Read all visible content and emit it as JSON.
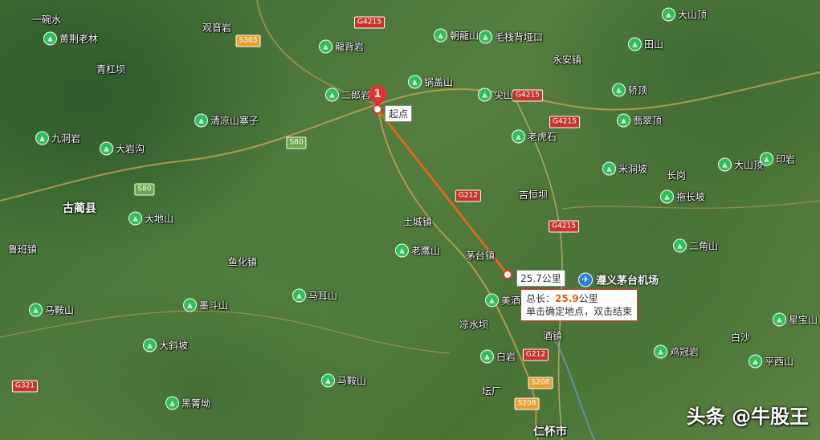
{
  "measure": {
    "start_marker_number": "1",
    "start_label": "起点",
    "segment_label": "25.7公里",
    "popup_total_prefix": "总长：",
    "popup_total_value": "25.9",
    "popup_total_unit": "公里",
    "popup_hint": "单击确定地点，双击结束",
    "line_color": "#e06a1e"
  },
  "airport": {
    "label": "遵义茅台机场",
    "icon": "airplane-icon",
    "color": "#2a7fd6"
  },
  "watermark": "头条 @牛股王",
  "road_shields": [
    {
      "text": "G4215",
      "type": "g"
    },
    {
      "text": "G4215",
      "type": "g"
    },
    {
      "text": "G4215",
      "type": "g"
    },
    {
      "text": "G4215",
      "type": "g"
    },
    {
      "text": "S303",
      "type": "s"
    },
    {
      "text": "S80",
      "type": "e"
    },
    {
      "text": "S80",
      "type": "e"
    },
    {
      "text": "G212",
      "type": "g"
    },
    {
      "text": "G212",
      "type": "g"
    },
    {
      "text": "S208",
      "type": "s"
    },
    {
      "text": "S208",
      "type": "s"
    },
    {
      "text": "G321",
      "type": "g"
    }
  ],
  "peaks": [
    "黄荆老林",
    "龍背岩",
    "二郎岩",
    "锅盖山",
    "尖山",
    "朝龍山",
    "毛栈背垭口",
    "大山顶",
    "田山",
    "轿顶",
    "翡翠顶",
    "清凉山寨子",
    "九洞岩",
    "大岩沟",
    "老虎石",
    "米洞坡",
    "大山顶",
    "印岩",
    "拖长坡",
    "大地山",
    "老鹰山",
    "马耳山",
    "二角山",
    "马鞍山",
    "墨斗山",
    "美酒岩",
    "大斜坡",
    "马鞍山",
    "黑箐坳",
    "白岩",
    "鸡冠岩",
    "星宝山",
    "平西山"
  ],
  "places": [
    {
      "text": "古蔺县",
      "big": true
    },
    {
      "text": "仁怀市",
      "big": true
    },
    {
      "text": "鲁班镇"
    },
    {
      "text": "土城镇"
    },
    {
      "text": "茅台镇"
    },
    {
      "text": "鱼化镇"
    },
    {
      "text": "青杠坝"
    },
    {
      "text": "吉恒坝"
    },
    {
      "text": "永安镇"
    },
    {
      "text": "一碗水"
    },
    {
      "text": "凉水坝"
    },
    {
      "text": "观音岩"
    },
    {
      "text": "白沙"
    },
    {
      "text": "长岗"
    },
    {
      "text": "酒镇"
    },
    {
      "text": "坛厂"
    }
  ]
}
